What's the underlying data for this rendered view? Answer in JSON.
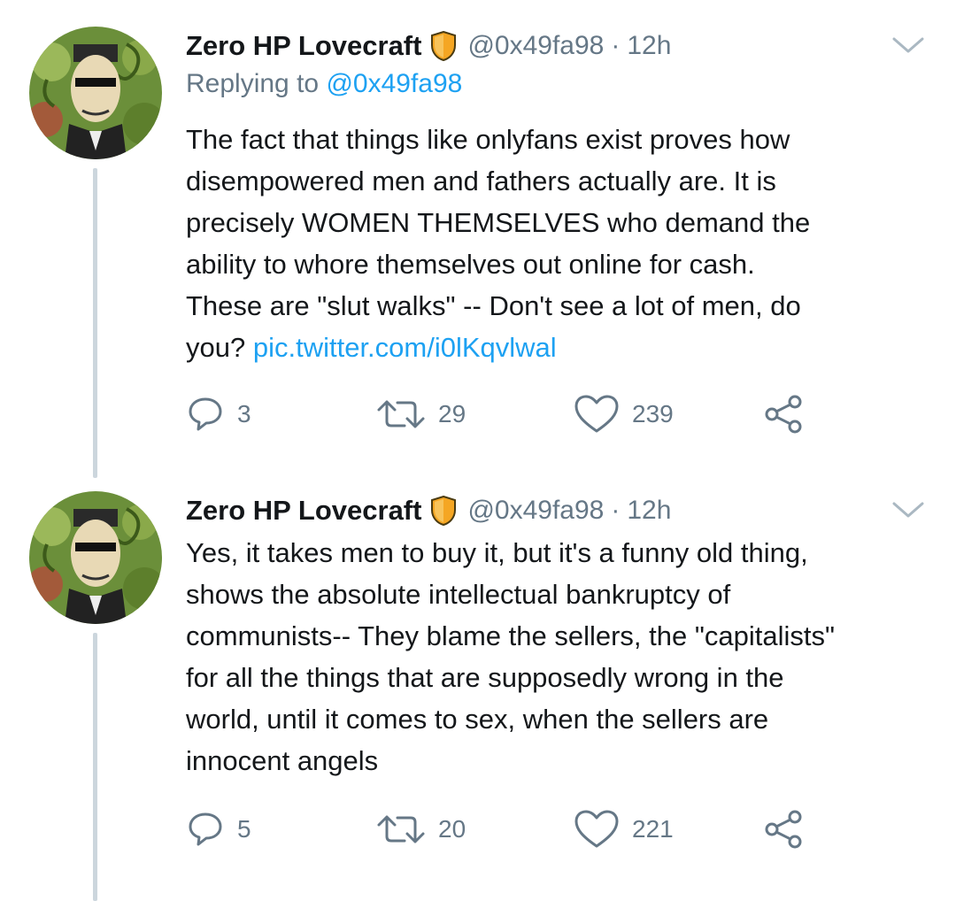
{
  "tweets": [
    {
      "author": {
        "name": "Zero HP Lovecraft",
        "handle": "@0x49fa98",
        "separator": "·",
        "time": "12h"
      },
      "replying_prefix": "Replying to ",
      "replying_to": "@0x49fa98",
      "text_lines": [
        "The fact that things like onlyfans exist proves how",
        "disempowered men and fathers actually are. It is",
        "precisely WOMEN THEMSELVES who demand the",
        "ability to whore themselves out online for cash.",
        "These are \"slut walks\" -- Don't see a lot of men, do"
      ],
      "last_line_text": "you? ",
      "link": "pic.twitter.com/i0lKqvlwal",
      "replies": "3",
      "retweets": "29",
      "likes": "239"
    },
    {
      "author": {
        "name": "Zero HP Lovecraft",
        "handle": "@0x49fa98",
        "separator": "·",
        "time": "12h"
      },
      "text_lines": [
        "Yes, it takes men to buy it, but it's a funny old thing,",
        "shows the absolute intellectual bankruptcy of",
        "communists-- They blame the sellers, the \"capitalists\"",
        "for all the things that are supposedly wrong in the",
        "world, until it comes to sex, when the sellers are",
        "innocent angels"
      ],
      "replies": "5",
      "retweets": "20",
      "likes": "221"
    }
  ],
  "colors": {
    "text": "#14171a",
    "secondary": "#657786",
    "link": "#1da1f2",
    "thread_line": "#ccd6dd",
    "badge": "#f5a623"
  },
  "icons": [
    "reply-icon",
    "retweet-icon",
    "like-icon",
    "share-icon",
    "chevron-down-icon",
    "shield-badge-icon"
  ]
}
